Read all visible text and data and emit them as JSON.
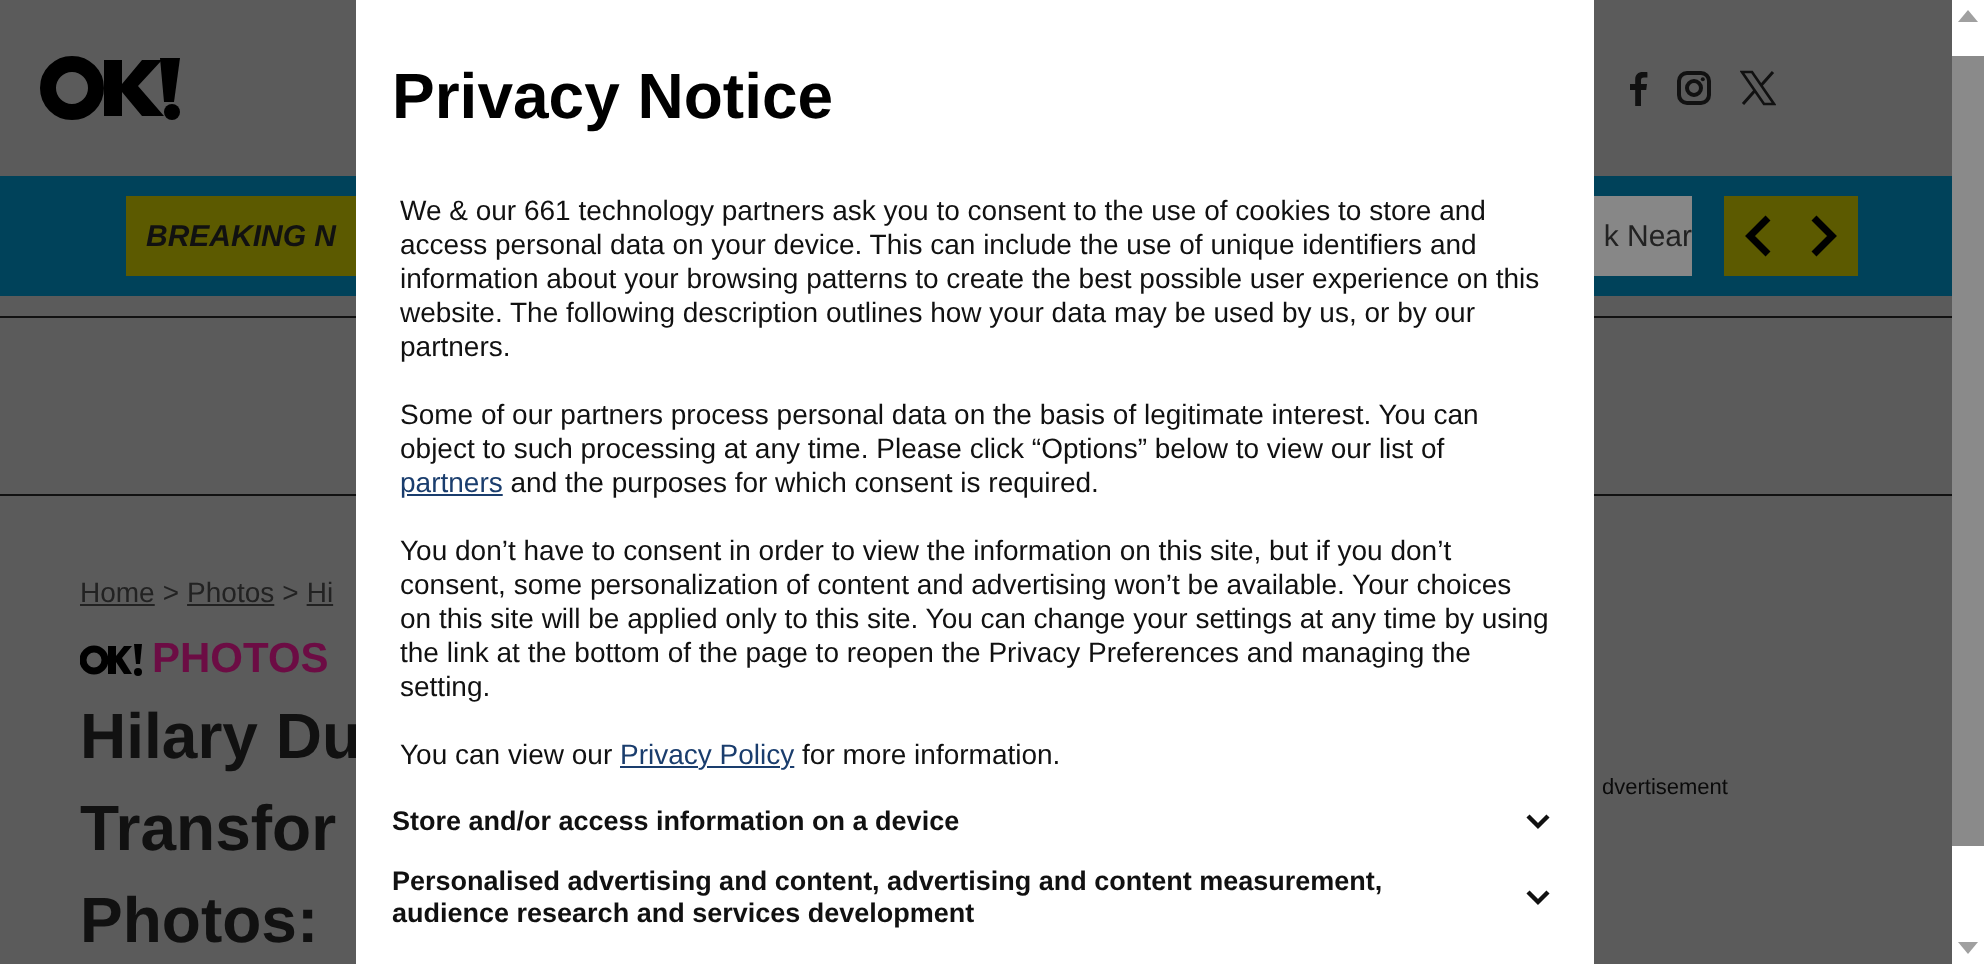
{
  "breaking_bar": {
    "label": "BREAKING N",
    "headline": "k Near"
  },
  "breadcrumb": [
    "Home",
    ">",
    "Photos",
    ">",
    "Hi"
  ],
  "section": "PHOTOS",
  "article_title": [
    "Hilary Du",
    "Transfor",
    "Photos:"
  ],
  "ad_label": "dvertisement",
  "privacy_notice": {
    "title": "Privacy Notice",
    "paragraphs": [
      [
        {
          "kind": "text",
          "text": "We & our 661 technology partners ask you to consent to the use of cookies to store and access personal data on your device. This can include the use of unique identifiers and information about your browsing patterns to create the best possible user experience on this website. The following description outlines how your data may be used by us, or by our partners."
        }
      ],
      [
        {
          "kind": "text",
          "text": "Some of our partners process personal data on the basis of legitimate interest. You can object to such processing at any time. Please click “Options” below to view our list of"
        },
        {
          "kind": "link",
          "text": "partners"
        },
        {
          "kind": "text",
          "text": "and the purposes for which consent is required."
        }
      ],
      [
        {
          "kind": "text",
          "text": "You don’t have to consent in order to view the information on this site, but if you don’t consent, some personalization of content and advertising won’t be available. Your choices on this site will be applied only to this site. You can change your settings at any time by using the link at the bottom of the page to reopen the Privacy Preferences and managing the setting."
        }
      ],
      [
        {
          "kind": "text",
          "text": "You can view our"
        },
        {
          "kind": "link",
          "text": "Privacy Policy"
        },
        {
          "kind": "text",
          "text": "for more information."
        }
      ]
    ],
    "sections": [
      {
        "label": "Store and/or access information on a device",
        "expanded": false
      },
      {
        "label": "Personalised advertising and content, advertising and content measurement, audience research and services development",
        "expanded": false
      }
    ]
  }
}
